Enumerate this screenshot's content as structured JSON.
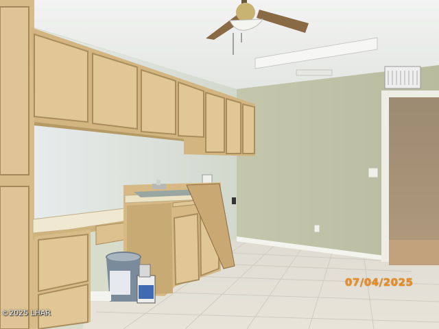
{
  "photo": {
    "date_stamp": "07/04/2025",
    "copyright": "©2025 LHAR"
  },
  "palette": {
    "wall": "#c9ccb4",
    "ceiling": "#eef0ee",
    "cabinet": "#dcc08c",
    "floor": "#e2ddd2",
    "date_stamp": "#f08c1e"
  }
}
